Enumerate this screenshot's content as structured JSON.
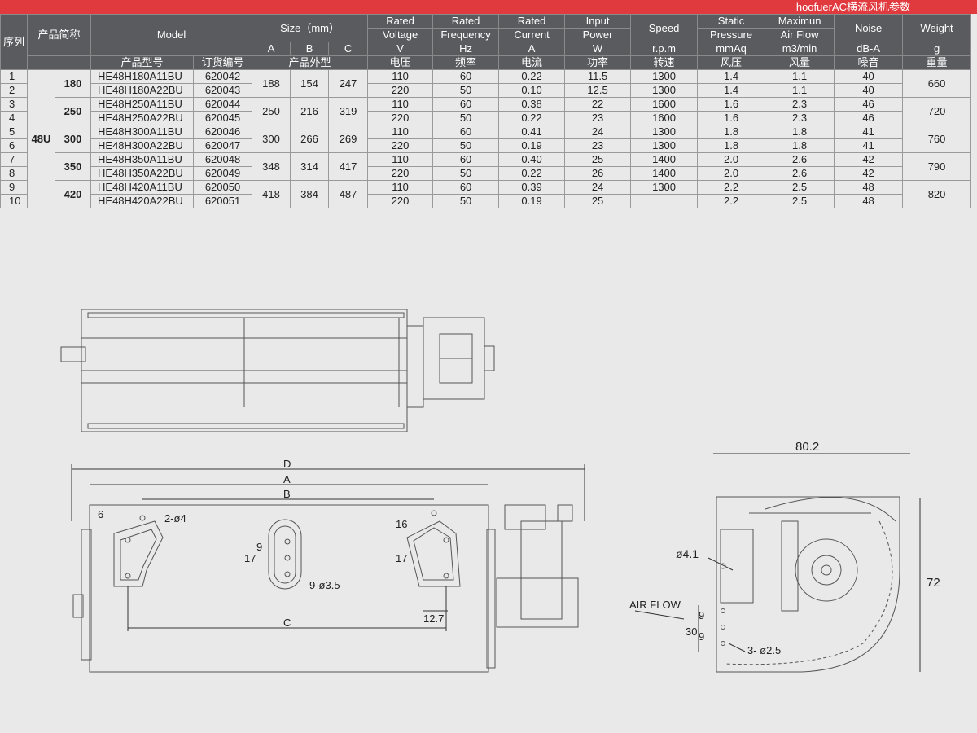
{
  "header": {
    "title": "hoofuerAC横流风机参数"
  },
  "table": {
    "h_seq": "序列",
    "h_short": "产品简称",
    "h_model": "Model",
    "h_size": "Size（mm）",
    "h_voltage": [
      "Rated",
      "Voltage"
    ],
    "h_frequency": [
      "Rated",
      "Frequency"
    ],
    "h_current": [
      "Rated",
      "Current"
    ],
    "h_power": [
      "Input",
      "Power"
    ],
    "h_speed": "Speed",
    "h_pressure": [
      "Static",
      "Pressure"
    ],
    "h_airflow": [
      "Maximun",
      "Air Flow"
    ],
    "h_noise": "Noise",
    "h_weight": "Weight",
    "sub": {
      "a": "A",
      "b": "B",
      "c": "C",
      "v": "V",
      "hz": "Hz",
      "amp": "A",
      "w": "W",
      "rpm": "r.p.m",
      "mmaq": "mmAq",
      "m3": "m3/min",
      "dba": "dB-A",
      "g": "g"
    },
    "cn": {
      "model": "产品型号",
      "order": "订货编号",
      "size": "产品外型",
      "voltage": "电压",
      "frequency": "频率",
      "current": "电流",
      "power": "功率",
      "speed": "转速",
      "pressure": "风压",
      "airflow": "风量",
      "noise": "噪音",
      "weight": "重量"
    },
    "series": "48U",
    "groups": [
      {
        "short": "180",
        "a": "188",
        "b": "154",
        "c": "247",
        "weight": "660",
        "rows": [
          {
            "idx": "1",
            "model": "HE48H180A11BU",
            "order": "620042",
            "v": "110",
            "hz": "60",
            "cur": "0.22",
            "pow": "11.5",
            "rpm": "1300",
            "pres": "1.4",
            "flow": "1.1",
            "noise": "40"
          },
          {
            "idx": "2",
            "model": "HE48H180A22BU",
            "order": "620043",
            "v": "220",
            "hz": "50",
            "cur": "0.10",
            "pow": "12.5",
            "rpm": "1300",
            "pres": "1.4",
            "flow": "1.1",
            "noise": "40"
          }
        ]
      },
      {
        "short": "250",
        "a": "250",
        "b": "216",
        "c": "319",
        "weight": "720",
        "rows": [
          {
            "idx": "3",
            "model": "HE48H250A11BU",
            "order": "620044",
            "v": "110",
            "hz": "60",
            "cur": "0.38",
            "pow": "22",
            "rpm": "1600",
            "pres": "1.6",
            "flow": "2.3",
            "noise": "46"
          },
          {
            "idx": "4",
            "model": "HE48H250A22BU",
            "order": "620045",
            "v": "220",
            "hz": "50",
            "cur": "0.22",
            "pow": "23",
            "rpm": "1600",
            "pres": "1.6",
            "flow": "2.3",
            "noise": "46"
          }
        ]
      },
      {
        "short": "300",
        "a": "300",
        "b": "266",
        "c": "269",
        "weight": "760",
        "rows": [
          {
            "idx": "5",
            "model": "HE48H300A11BU",
            "order": "620046",
            "v": "110",
            "hz": "60",
            "cur": "0.41",
            "pow": "24",
            "rpm": "1300",
            "pres": "1.8",
            "flow": "1.8",
            "noise": "41"
          },
          {
            "idx": "6",
            "model": "HE48H300A22BU",
            "order": "620047",
            "v": "220",
            "hz": "50",
            "cur": "0.19",
            "pow": "23",
            "rpm": "1300",
            "pres": "1.8",
            "flow": "1.8",
            "noise": "41"
          }
        ]
      },
      {
        "short": "350",
        "a": "348",
        "b": "314",
        "c": "417",
        "weight": "790",
        "rows": [
          {
            "idx": "7",
            "model": "HE48H350A11BU",
            "order": "620048",
            "v": "110",
            "hz": "60",
            "cur": "0.40",
            "pow": "25",
            "rpm": "1400",
            "pres": "2.0",
            "flow": "2.6",
            "noise": "42"
          },
          {
            "idx": "8",
            "model": "HE48H350A22BU",
            "order": "620049",
            "v": "220",
            "hz": "50",
            "cur": "0.22",
            "pow": "26",
            "rpm": "1400",
            "pres": "2.0",
            "flow": "2.6",
            "noise": "42"
          }
        ]
      },
      {
        "short": "420",
        "a": "418",
        "b": "384",
        "c": "487",
        "weight": "820",
        "rows": [
          {
            "idx": "9",
            "model": "HE48H420A11BU",
            "order": "620050",
            "v": "110",
            "hz": "60",
            "cur": "0.39",
            "pow": "24",
            "rpm": "1300",
            "pres": "2.2",
            "flow": "2.5",
            "noise": "48"
          },
          {
            "idx": "10",
            "model": "HE48H420A22BU",
            "order": "620051",
            "v": "220",
            "hz": "50",
            "cur": "0.19",
            "pow": "25",
            "rpm": "",
            "pres": "2.2",
            "flow": "2.5",
            "noise": "48"
          }
        ]
      }
    ]
  },
  "drawing": {
    "dim_d": "D",
    "dim_a": "A",
    "dim_b": "B",
    "dim_c": "C",
    "dim_6": "6",
    "dim_2x4": "2-ø4",
    "dim_16": "16",
    "dim_17a": "17",
    "dim_9a": "9",
    "dim_17b": "17",
    "dim_9x35": "9-ø3.5",
    "dim_127": "12.7",
    "dim_802": "80.2",
    "dim_72": "72",
    "dim_41": "ø4.1",
    "air_flow": "AIR FLOW",
    "dim_30": "30",
    "dim_9b": "9",
    "dim_9c": "9",
    "dim_3x25": "3- ø2.5"
  }
}
